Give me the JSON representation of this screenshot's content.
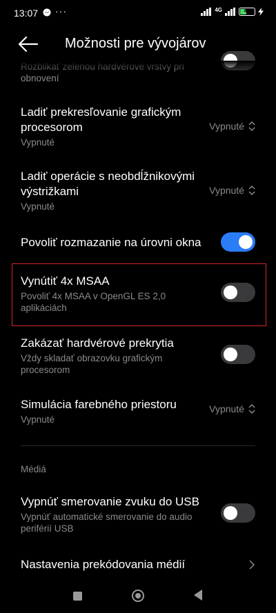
{
  "status": {
    "time": "13:07",
    "network": "4G",
    "battery": "42"
  },
  "header": {
    "title": "Možnosti pre vývojárov"
  },
  "items": [
    {
      "subtitle": "Rozblikať zelenou hardvérové vrstvy pri obnovení",
      "toggle": "off"
    },
    {
      "title": "Ladiť prekresľovanie grafickým procesorom",
      "subtitle": "Vypnuté",
      "value": "Vypnuté"
    },
    {
      "title": "Ladiť operácie s neobdĺžnikovými výstrižkami",
      "subtitle": "Vypnuté",
      "value": "Vypnuté"
    },
    {
      "title": "Povoliť rozmazanie na úrovni okna",
      "toggle": "on"
    },
    {
      "title": "Vynútiť 4x MSAA",
      "subtitle": "Povoliť 4x MSAA v OpenGL ES 2,0 aplikáciách",
      "toggle": "off"
    },
    {
      "title": "Zakázať hardvérové prekrytia",
      "subtitle": "Vždy skladať obrazovku grafickým procesorom",
      "toggle": "off"
    },
    {
      "title": "Simulácia farebného priestoru",
      "subtitle": "Vypnuté",
      "value": "Vypnuté"
    },
    {
      "title": "Vypnúť smerovanie zvuku do USB",
      "subtitle": "Vypnúť automatické smerovanie do audio periférií USB",
      "toggle": "off"
    },
    {
      "title": "Nastavenia prekódovania médií"
    }
  ],
  "section": {
    "media": "Médiá"
  },
  "colors": {
    "accent": "#2a7cf7",
    "highlight": "#d7262c"
  }
}
